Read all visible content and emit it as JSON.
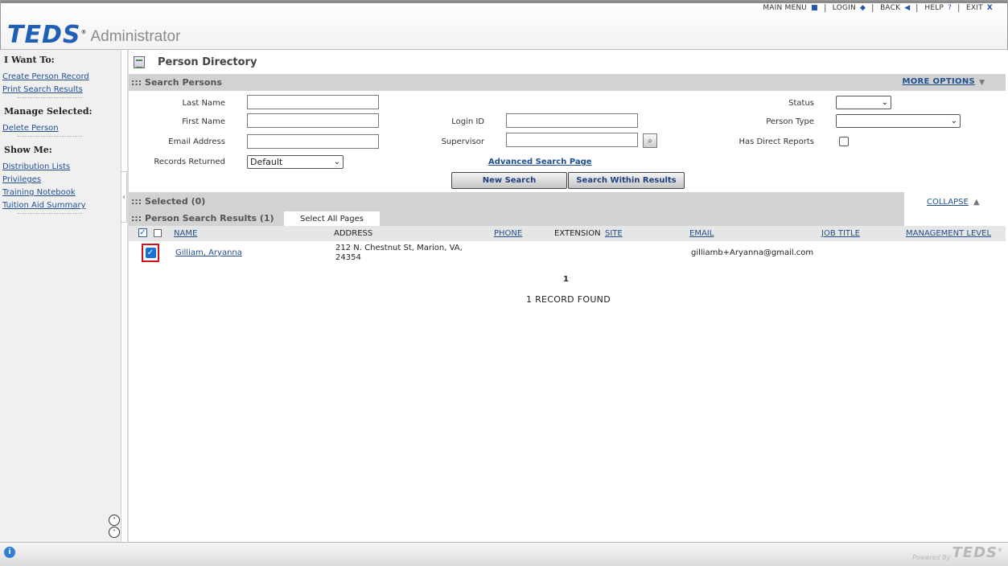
{
  "topnav": {
    "main_menu": "MAIN MENU",
    "login": "LOGIN",
    "back": "BACK",
    "help": "HELP",
    "help_glyph": "?",
    "exit": "EXIT",
    "exit_glyph": "X"
  },
  "app": {
    "logo": "TEDS",
    "registered": "®",
    "title": "Administrator"
  },
  "sidebar": {
    "i_want_to": "I Want To:",
    "want_links": [
      "Create Person Record",
      "Print Search Results"
    ],
    "manage_selected": "Manage Selected:",
    "manage_links": [
      "Delete Person"
    ],
    "show_me": "Show Me:",
    "show_links": [
      "Distribution Lists",
      "Privileges",
      "Training Notebook",
      "Tuition Aid Summary"
    ],
    "collapse_glyph": "‹",
    "scroll_up": "˄",
    "scroll_down": "˅"
  },
  "page": {
    "title": "Person Directory"
  },
  "search": {
    "section_title": "::: Search Persons",
    "more_options": "MORE OPTIONS",
    "fields": {
      "last_name_label": "Last Name",
      "first_name_label": "First Name",
      "email_label": "Email Address",
      "records_returned_label": "Records Returned",
      "records_returned_value": "Default",
      "login_id_label": "Login ID",
      "supervisor_label": "Supervisor",
      "status_label": "Status",
      "person_type_label": "Person Type",
      "has_direct_reports_label": "Has Direct Reports"
    },
    "advanced_link": "Advanced Search Page",
    "new_search": "New Search",
    "search_within": "Search Within Results"
  },
  "selected": {
    "label": "::: Selected (0)",
    "collapse": "COLLAPSE"
  },
  "results": {
    "label": "::: Person Search Results (1)",
    "select_all": "Select All Pages",
    "columns": {
      "name": "NAME",
      "address": "ADDRESS",
      "phone": "PHONE",
      "extension": "EXTENSION",
      "site": "SITE",
      "email": "EMAIL",
      "job_title": "JOB TITLE",
      "management_level": "MANAGEMENT LEVEL"
    },
    "rows": [
      {
        "checked": true,
        "name": "Gilliam, Aryanna",
        "address_line1": "212 N. Chestnut St, Marion, VA,",
        "address_line2": "24354",
        "email": "gilliamb+Aryanna@gmail.com"
      }
    ],
    "page": "1",
    "records_found": "1  RECORD FOUND"
  },
  "footer": {
    "info_glyph": "i",
    "powered_by": "Powered By",
    "brand": "TEDS",
    "registered": "®"
  }
}
